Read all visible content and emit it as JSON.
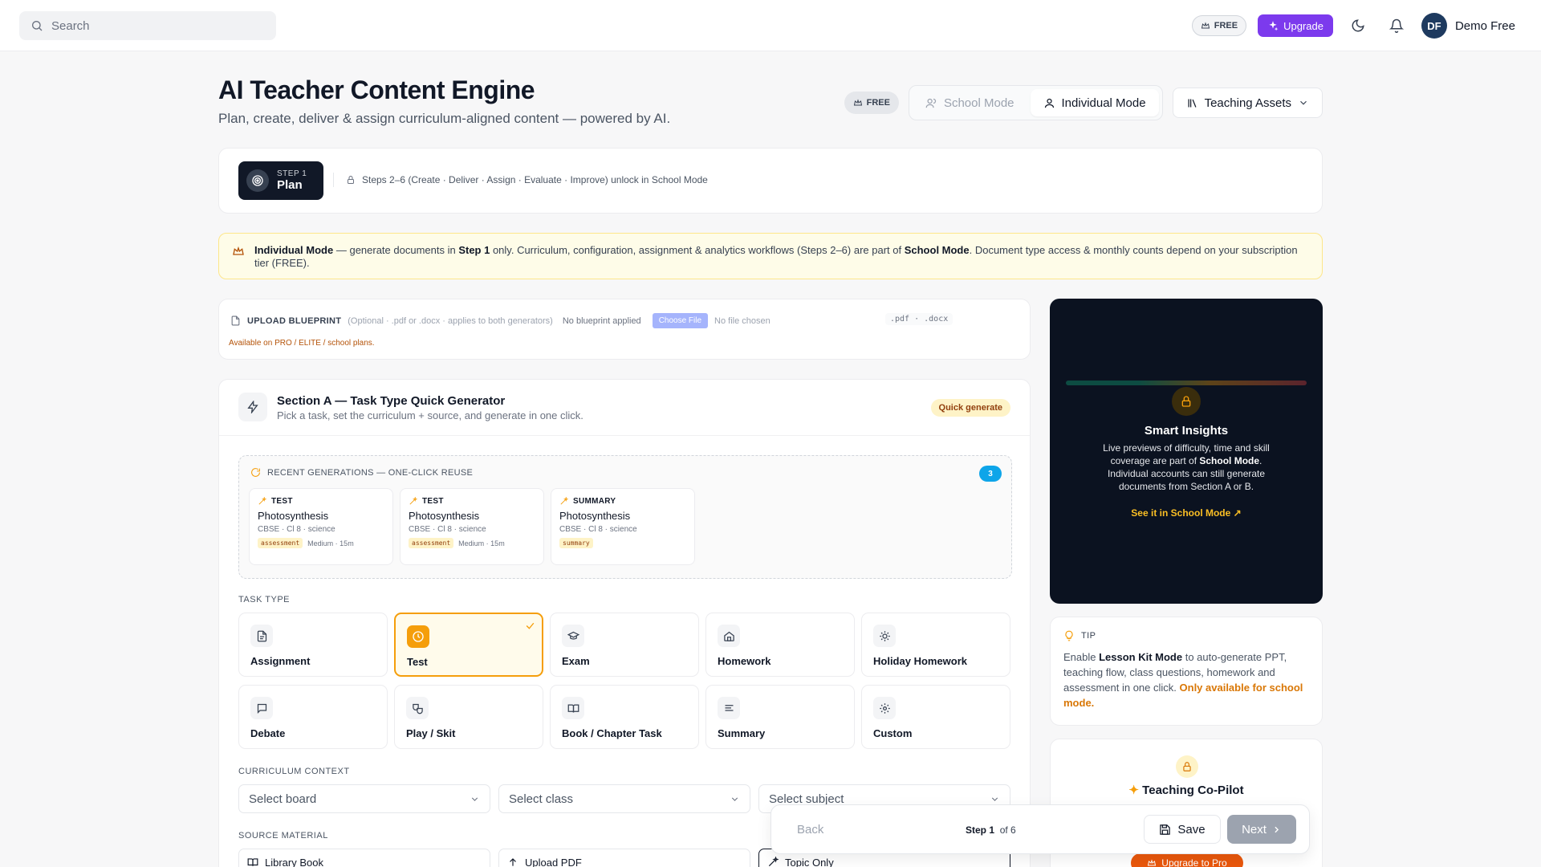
{
  "topbar": {
    "search_placeholder": "Search",
    "plan_badge": "FREE",
    "upgrade_label": "Upgrade",
    "user_initials": "DF",
    "user_name": "Demo Free"
  },
  "header": {
    "title": "AI Teacher Content Engine",
    "subtitle": "Plan, create, deliver & assign curriculum-aligned content — powered by AI.",
    "plan_badge": "FREE",
    "modes": [
      "School Mode",
      "Individual Mode"
    ],
    "active_mode": "Individual Mode",
    "assets_label": "Teaching Assets"
  },
  "stepper": {
    "step_kicker": "STEP 1",
    "step_name": "Plan",
    "locked_note": "Steps 2–6 (Create · Deliver · Assign · Evaluate · Improve) unlock in School Mode"
  },
  "notice": {
    "mode_name": "Individual Mode",
    "part1": " — generate documents in ",
    "step": "Step 1",
    "part2": " only. Curriculum, configuration, assignment & analytics workflows (Steps 2–6) are part of ",
    "school_mode": "School Mode",
    "part3": ". Document type access & monthly counts depend on your subscription tier (FREE)."
  },
  "upload": {
    "label": "UPLOAD BLUEPRINT",
    "optional": "(Optional · .pdf or .docx · applies to both generators)",
    "applied": "No blueprint applied",
    "choose": "Choose File",
    "no_file": "No file chosen",
    "extensions": ".pdf · .docx",
    "availability": "Available on PRO / ELITE / school plans."
  },
  "sectionA": {
    "title": "Section A — Task Type Quick Generator",
    "subtitle": "Pick a task, set the curriculum + source, and generate in one click.",
    "badge": "Quick generate",
    "recent_label": "RECENT GENERATIONS — ONE-CLICK REUSE",
    "recent_count": "3",
    "recent": [
      {
        "type": "TEST",
        "name": "Photosynthesis",
        "meta": "CBSE · Cl 8 · science",
        "tag": "assessment",
        "extra": "Medium · 15m"
      },
      {
        "type": "TEST",
        "name": "Photosynthesis",
        "meta": "CBSE · Cl 8 · science",
        "tag": "assessment",
        "extra": "Medium · 15m"
      },
      {
        "type": "SUMMARY",
        "name": "Photosynthesis",
        "meta": "CBSE · Cl 8 · science",
        "tag": "summary",
        "extra": ""
      }
    ],
    "task_type_label": "TASK TYPE",
    "task_types": [
      {
        "label": "Assignment",
        "icon": "document-icon"
      },
      {
        "label": "Test",
        "icon": "clock-icon"
      },
      {
        "label": "Exam",
        "icon": "graduation-cap-icon"
      },
      {
        "label": "Homework",
        "icon": "home-icon"
      },
      {
        "label": "Holiday Homework",
        "icon": "sun-icon"
      },
      {
        "label": "Debate",
        "icon": "speech-bubble-icon"
      },
      {
        "label": "Play / Skit",
        "icon": "theater-masks-icon"
      },
      {
        "label": "Book / Chapter Task",
        "icon": "open-book-icon"
      },
      {
        "label": "Summary",
        "icon": "text-lines-icon"
      },
      {
        "label": "Custom",
        "icon": "gear-icon"
      }
    ],
    "selected_task": "Test",
    "curriculum_label": "CURRICULUM CONTEXT",
    "board_placeholder": "Select board",
    "class_placeholder": "Select class",
    "subject_placeholder": "Select subject",
    "source_label": "SOURCE MATERIAL",
    "sources": [
      "Library Book",
      "Upload PDF",
      "Topic Only"
    ],
    "active_source": "Topic Only"
  },
  "insights": {
    "title": "Smart Insights",
    "body_1": "Live previews of difficulty, time and skill coverage are part of ",
    "school_mode": "School Mode",
    "body_2": ". Individual accounts can still generate documents from Section A or B.",
    "link": "See it in School Mode ↗"
  },
  "tip": {
    "label": "TIP",
    "text_1": "Enable ",
    "lesson_kit": "Lesson Kit Mode",
    "text_2": " to auto-generate PPT, teaching flow, class questions, homework and assessment in one click. ",
    "only": "Only available for school mode."
  },
  "copilot": {
    "title": "Teaching Co-Pilot",
    "upgrade": "Upgrade to Pro"
  },
  "footer_nav": {
    "back": "Back",
    "step_current": "Step 1",
    "step_total": "of 6",
    "save": "Save",
    "next": "Next"
  },
  "colors": {
    "accent_purple": "#7c3aed",
    "accent_amber": "#f59e0b",
    "insight_bg": "#0b1220",
    "upgrade_orange": "#ea580c"
  }
}
